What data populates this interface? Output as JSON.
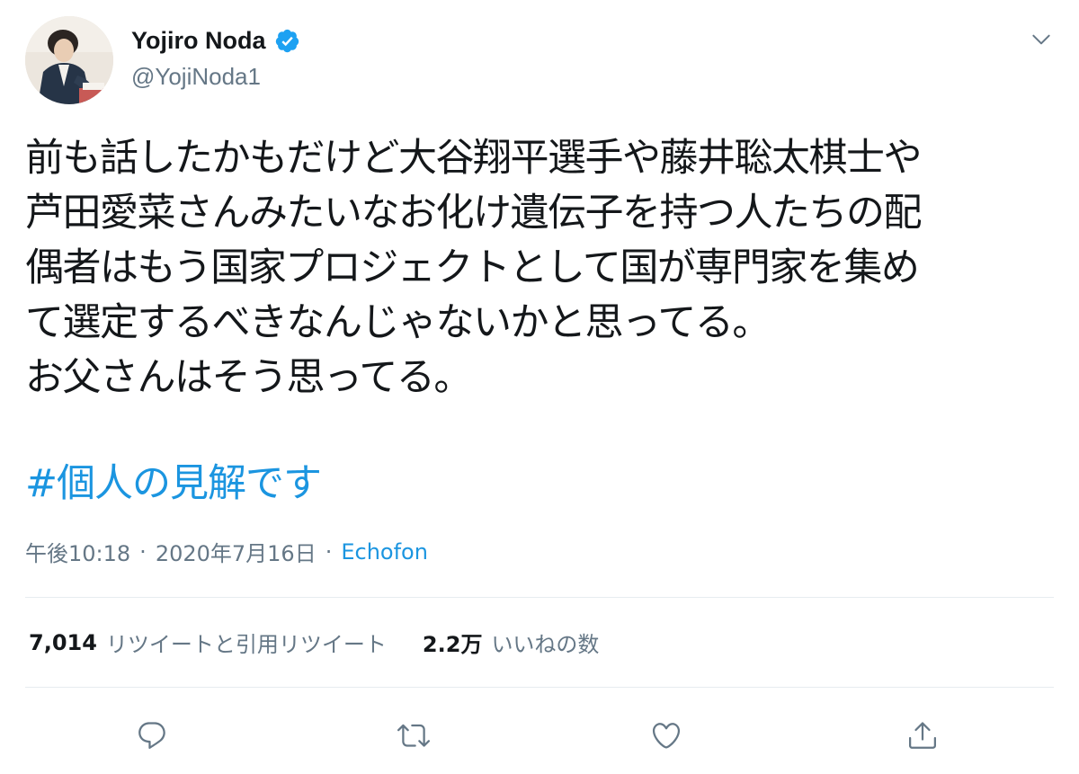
{
  "author": {
    "display_name": "Yojiro Noda",
    "handle": "@YojiNoda1",
    "verified": true
  },
  "tweet": {
    "lines": [
      "前も話したかもだけど大谷翔平選手や藤井聡太棋士や",
      "芦田愛菜さんみたいなお化け遺伝子を持つ人たちの配",
      "偶者はもう国家プロジェクトとして国が専門家を集め",
      "て選定するべきなんじゃないかと思ってる。",
      "お父さんはそう思ってる。"
    ],
    "hashtag": "#個人の見解です"
  },
  "meta": {
    "time": "午後10:18",
    "date": "2020年7月16日",
    "separator": "·",
    "source": "Echofon"
  },
  "stats": {
    "retweets_count": "7,014",
    "retweets_label": "リツイートと引用リツイート",
    "likes_count": "2.2万",
    "likes_label": "いいねの数"
  },
  "icons": {
    "verified": "verified-badge-icon",
    "caret": "chevron-down-icon",
    "reply": "reply-icon",
    "retweet": "retweet-icon",
    "like": "heart-icon",
    "share": "share-icon"
  },
  "colors": {
    "text": "#14171a",
    "secondary": "#657786",
    "link": "#1b95e0",
    "verified": "#1da1f2",
    "divider": "#e6ecf0"
  }
}
